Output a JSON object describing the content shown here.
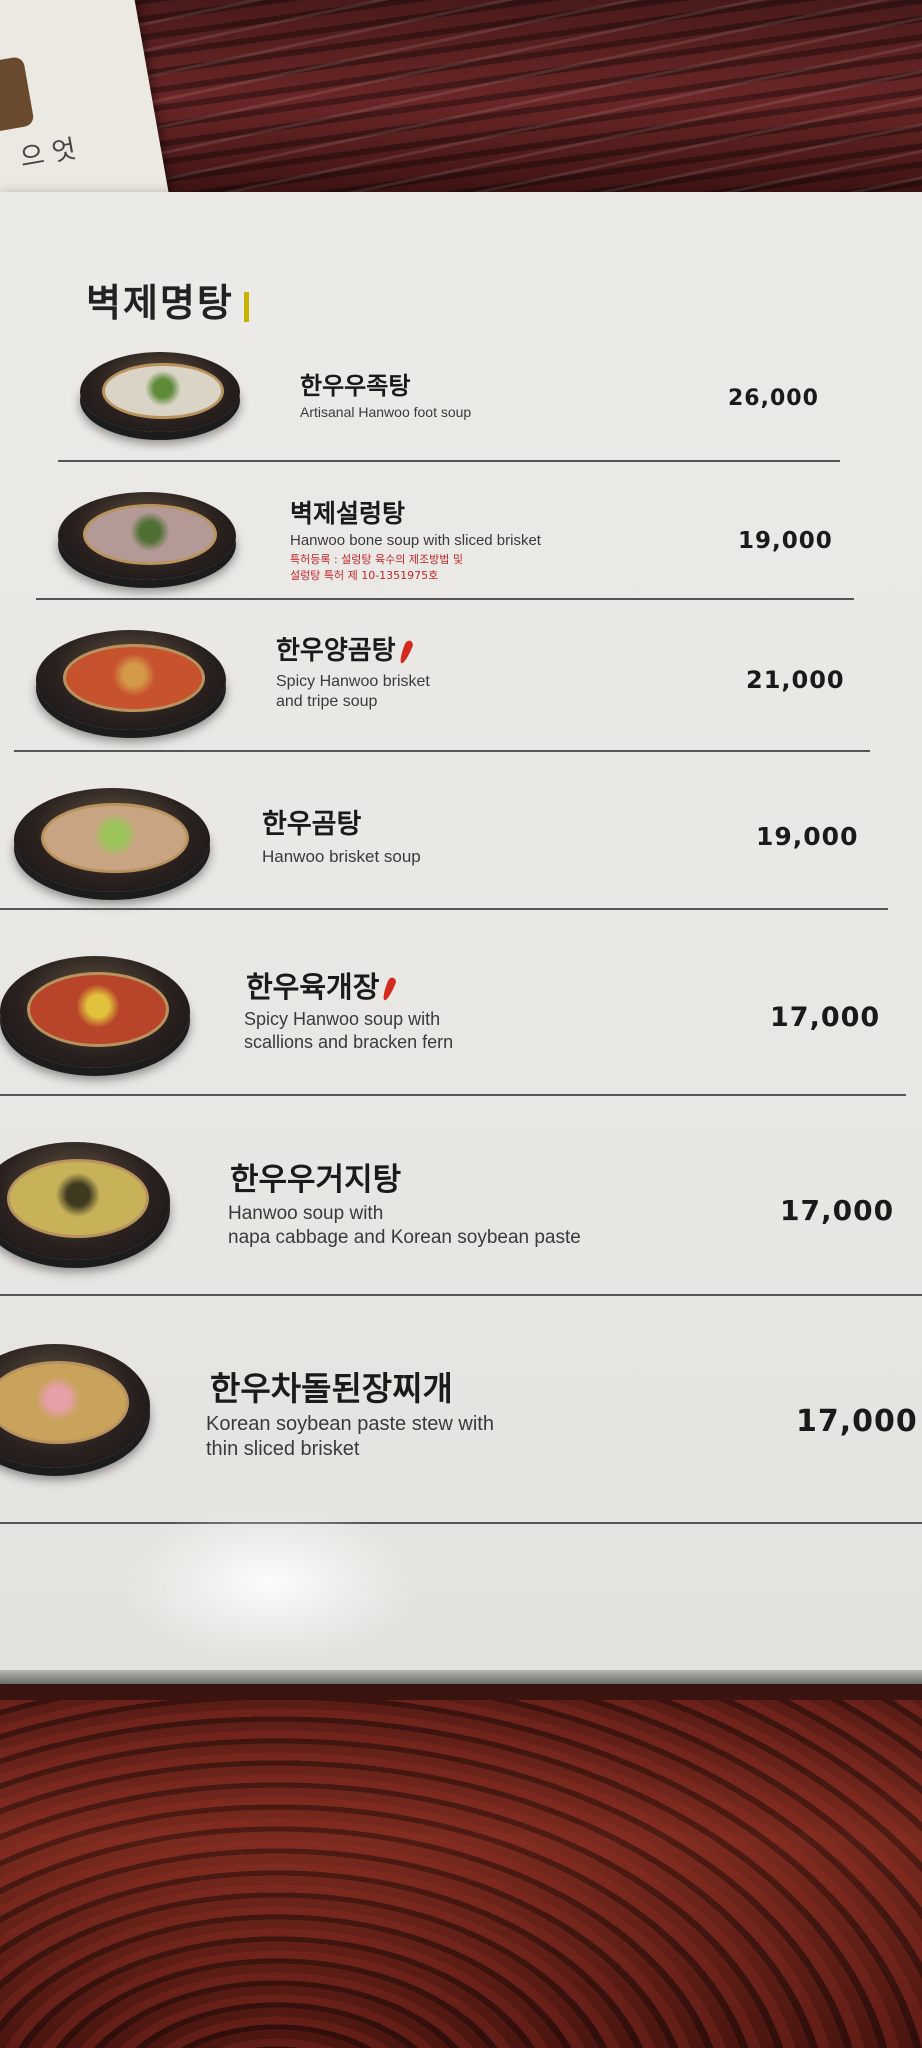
{
  "corner_card": {
    "text": "으 엇"
  },
  "section": {
    "title": "벽제명탕"
  },
  "items": [
    {
      "name": "한우우족탕",
      "desc": "Artisanal Hanwoo foot soup",
      "price": "26,000",
      "spicy": false,
      "note": "",
      "soup_color": "#d9d4c6",
      "garnish_color": "#5f8a3a"
    },
    {
      "name": "벽제설렁탕",
      "desc": "Hanwoo bone soup with sliced brisket",
      "price": "19,000",
      "spicy": false,
      "note": "특허등록 : 설렁탕 육수의 제조방법 및\n설렁탕 특허 제 10-1351975호",
      "soup_color": "#b49a96",
      "garnish_color": "#4f6f33"
    },
    {
      "name": "한우양곰탕",
      "desc": "Spicy Hanwoo brisket\nand tripe soup",
      "price": "21,000",
      "spicy": true,
      "note": "",
      "soup_color": "#c7532e",
      "garnish_color": "#d49a4a"
    },
    {
      "name": "한우곰탕",
      "desc": "Hanwoo brisket soup",
      "price": "19,000",
      "spicy": false,
      "note": "",
      "soup_color": "#c9a482",
      "garnish_color": "#9cc35a"
    },
    {
      "name": "한우육개장",
      "desc": "Spicy Hanwoo soup with\nscallions and bracken fern",
      "price": "17,000",
      "spicy": true,
      "note": "",
      "soup_color": "#b8452a",
      "garnish_color": "#e2c23c"
    },
    {
      "name": "한우우거지탕",
      "desc": "Hanwoo soup with\nnapa cabbage and Korean soybean paste",
      "price": "17,000",
      "spicy": false,
      "note": "",
      "soup_color": "#c7b25a",
      "garnish_color": "#3d3a20"
    },
    {
      "name": "한우차돌된장찌개",
      "desc": "Korean soybean paste stew with\nthin sliced brisket",
      "price": "17,000",
      "spicy": false,
      "note": "",
      "soup_color": "#c9a25c",
      "garnish_color": "#e6a0a8"
    }
  ]
}
